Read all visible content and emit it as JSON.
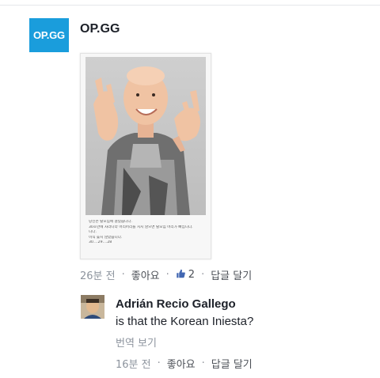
{
  "post": {
    "avatar_text": "OP.GG",
    "page_name": "OP.GG",
    "image_caption": [
      "당신은 탈모임에 걸렸습니다.",
      "30초안에 자라나라 머리머리를 치지 않으면 탈모임 머리가 빠집니다.",
      "니다.",
      "이직 늦지 않았습니다.",
      "30....29....28"
    ],
    "meta": {
      "time": "26분 전",
      "like": "좋아요",
      "like_count": "2",
      "reply": "답글 달기",
      "separator": "·"
    }
  },
  "comment": {
    "author": "Adrián Recio Gallego",
    "text": "is that the Korean Iniesta?",
    "translate": "번역 보기",
    "meta": {
      "time": "16분 전",
      "like": "좋아요",
      "reply": "답글 달기",
      "separator": "·"
    }
  },
  "colors": {
    "brand": "#1a9ddc",
    "meta_text": "#90949c",
    "like_icon": "#4267b2"
  }
}
